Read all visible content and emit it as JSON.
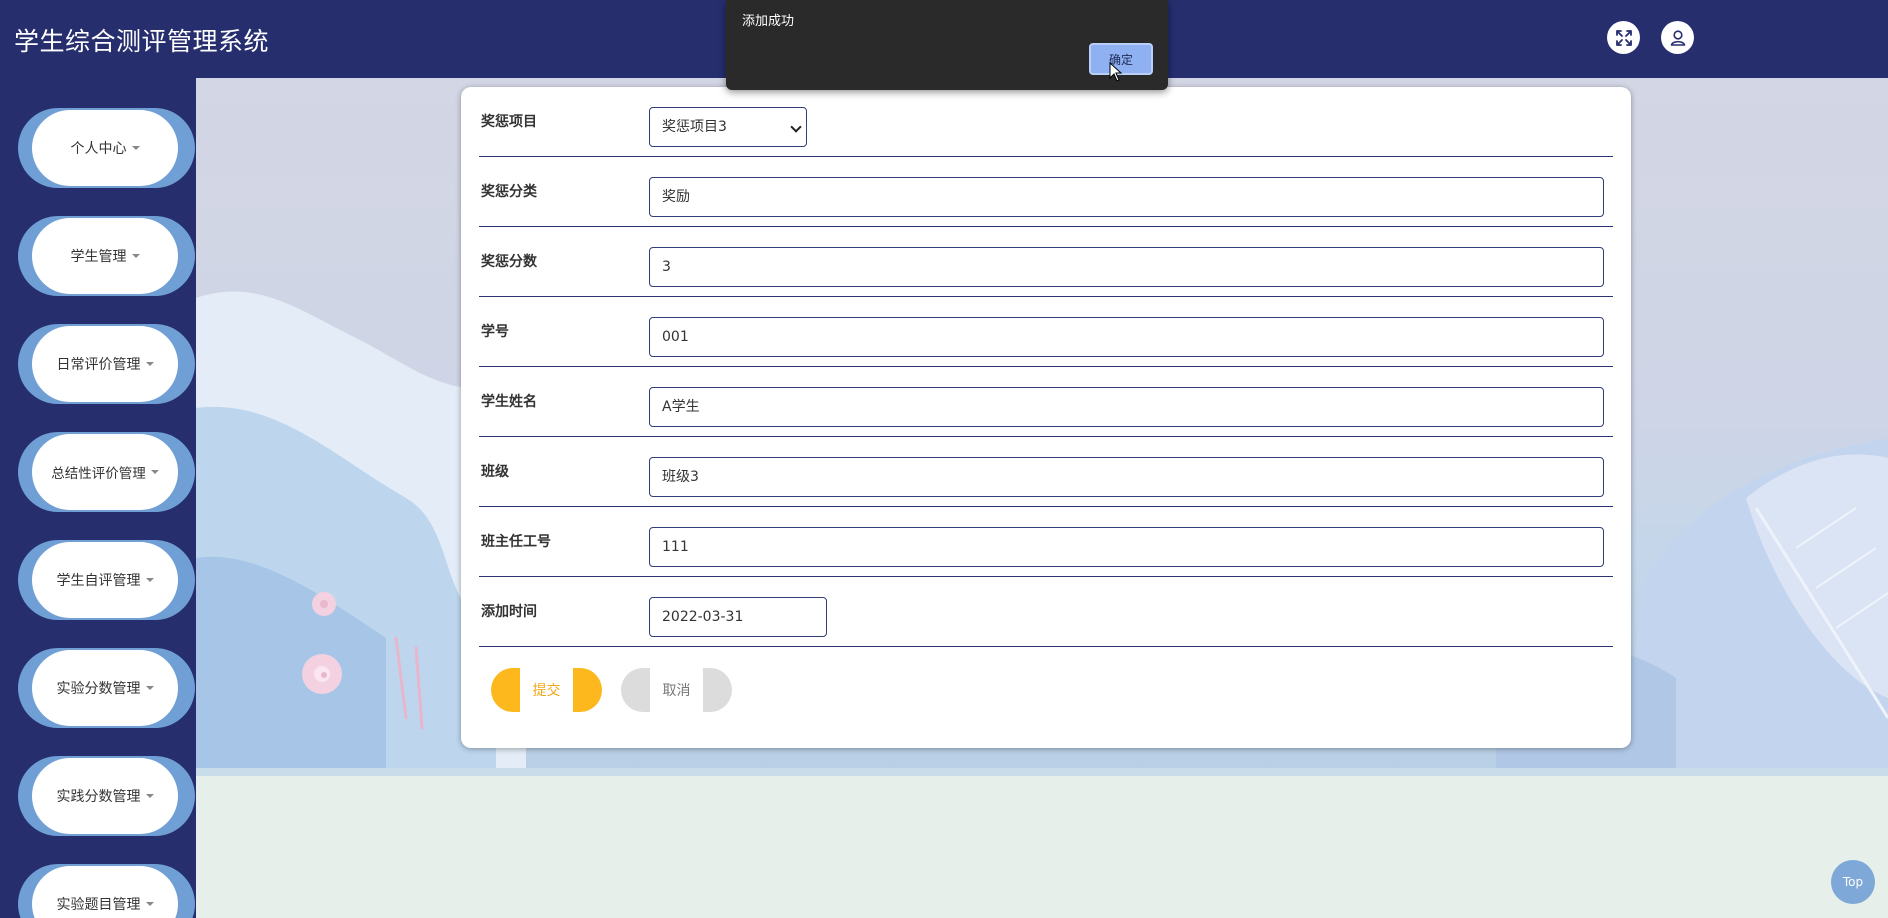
{
  "app": {
    "title": "学生综合测评管理系统"
  },
  "header": {
    "fullscreen_icon": "fullscreen-icon",
    "user_icon": "user-icon"
  },
  "sidebar": {
    "items": [
      {
        "label": "个人中心"
      },
      {
        "label": "学生管理"
      },
      {
        "label": "日常评价管理"
      },
      {
        "label": "总结性评价管理"
      },
      {
        "label": "学生自评管理"
      },
      {
        "label": "实验分数管理"
      },
      {
        "label": "实践分数管理"
      },
      {
        "label": "实验题目管理"
      }
    ]
  },
  "form": {
    "project": {
      "label": "奖惩项目",
      "value": "奖惩项目3"
    },
    "category": {
      "label": "奖惩分类",
      "value": "奖励"
    },
    "score": {
      "label": "奖惩分数",
      "value": "3"
    },
    "student_no": {
      "label": "学号",
      "value": "001"
    },
    "student_name": {
      "label": "学生姓名",
      "value": "A学生"
    },
    "class": {
      "label": "班级",
      "value": "班级3"
    },
    "teacher_no": {
      "label": "班主任工号",
      "value": "111"
    },
    "added_time": {
      "label": "添加时间",
      "value": "2022-03-31"
    },
    "submit_label": "提交",
    "cancel_label": "取消"
  },
  "alert": {
    "message": "添加成功",
    "ok_label": "确定"
  },
  "back_to_top": {
    "label": "Top"
  },
  "colors": {
    "header_bg": "#262e6e",
    "sidebar_accent": "#6f9fd5",
    "submit": "#fcb81c",
    "cancel": "#dcdcdc",
    "alert_bg": "#2a2a2a",
    "alert_ok": "#8fb0f1"
  }
}
